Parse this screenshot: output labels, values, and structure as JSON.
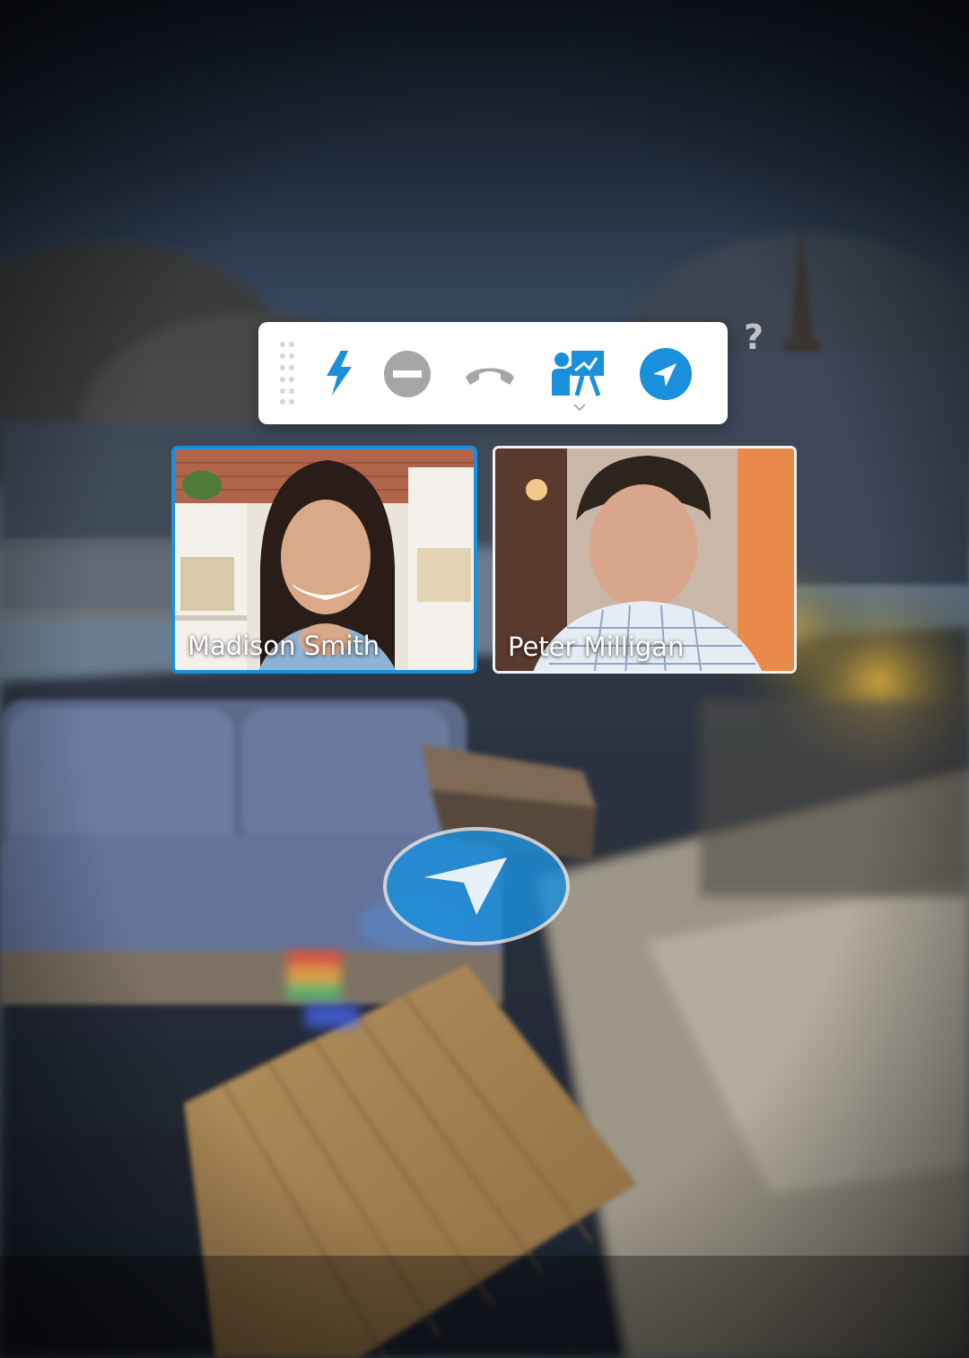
{
  "toolbar": {
    "items": [
      {
        "name": "drag-handle",
        "icon": "grip-dots-icon"
      },
      {
        "name": "flash",
        "icon": "lightning-icon",
        "color": "#1a8fdc"
      },
      {
        "name": "do-not-disturb",
        "icon": "minus-circle-icon",
        "color": "#a6a6a6"
      },
      {
        "name": "hang-up",
        "icon": "phone-hangup-icon",
        "color": "#a6a6a6"
      },
      {
        "name": "presenter",
        "icon": "presenter-whiteboard-icon",
        "color": "#1a8fdc"
      },
      {
        "name": "navigate",
        "icon": "navigation-arrow-icon",
        "color": "#1a8fdc"
      }
    ]
  },
  "help": {
    "label": "?"
  },
  "participants": [
    {
      "name": "Madison Smith",
      "active": true,
      "border_color": "#1a8fdc"
    },
    {
      "name": "Peter Milligan",
      "active": false,
      "border_color": "#f2f2f2"
    }
  ],
  "colors": {
    "accent": "#1a8fdc",
    "muted": "#a6a6a6",
    "toolbar_bg": "#ffffff"
  }
}
